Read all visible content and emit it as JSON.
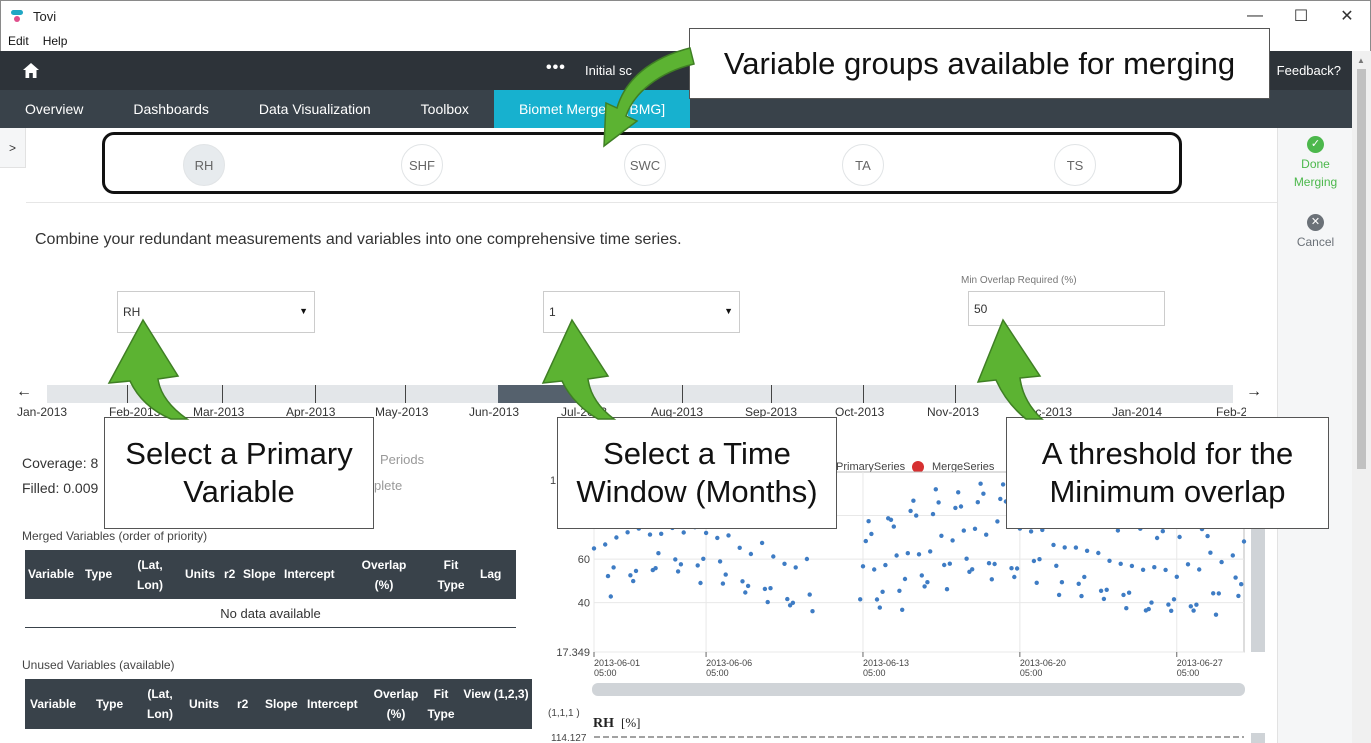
{
  "window": {
    "title": "Tovi",
    "controls": [
      "—",
      "☐",
      "✕"
    ]
  },
  "menu": [
    "Edit",
    "Help"
  ],
  "appbar": {
    "more": "•••",
    "project": "Initial sc",
    "feedback": "Feedback?"
  },
  "nav": {
    "tabs": [
      {
        "label": "Overview"
      },
      {
        "label": "Dashboards"
      },
      {
        "label": "Data Visualization"
      },
      {
        "label": "Toolbox"
      },
      {
        "label": "Biomet Merge ... [BMG]",
        "active": true
      }
    ]
  },
  "groups": [
    "RH",
    "SHF",
    "SWC",
    "TA",
    "TS"
  ],
  "right_panel": {
    "done": "Done Merging",
    "cancel": "Cancel"
  },
  "intro": "Combine your redundant measurements and variables into one comprehensive time series.",
  "controls": {
    "primary_variable": "RH",
    "time_window": "1",
    "min_overlap_label": "Min Overlap Required (%)",
    "min_overlap_value": "50"
  },
  "timeline": {
    "months": [
      "Jan-2013",
      "Feb-2013",
      "Mar-2013",
      "Apr-2013",
      "May-2013",
      "Jun-2013",
      "Jul-2013",
      "Aug-2013",
      "Sep-2013",
      "Oct-2013",
      "Nov-2013",
      "Dec-2013",
      "Jan-2014",
      "Feb-2014"
    ]
  },
  "stats": {
    "coverage": "Coverage: 8",
    "filled": "Filled: 0.009",
    "periods": "Periods",
    "complete": "plete"
  },
  "merged": {
    "title": "Merged Variables (order of priority)",
    "headers": [
      "Variable",
      "Type",
      "(Lat, Lon)",
      "Units",
      "r2",
      "Slope",
      "Intercept",
      "Overlap (%)",
      "Fit Type",
      "Lag"
    ],
    "empty": "No data available"
  },
  "unused": {
    "title": "Unused Variables (available)",
    "headers": [
      "Variable",
      "Type",
      "(Lat, Lon)",
      "Units",
      "r2",
      "Slope",
      "Intercept",
      "Overlap (%)",
      "Fit Type",
      "View (1,2,3)"
    ]
  },
  "chart_data": {
    "type": "scatter",
    "legend": [
      {
        "name": "PrimarySeries",
        "color": "#3e7cc4"
      },
      {
        "name": "MergeSeries",
        "color": "#d63031"
      }
    ],
    "y_ticks": [
      "17.349",
      "40",
      "60",
      "80"
    ],
    "y_top_partial": "1",
    "x_ticks": [
      {
        "date": "2013-06-01",
        "time": "05:00"
      },
      {
        "date": "2013-06-06",
        "time": "05:00"
      },
      {
        "date": "2013-06-13",
        "time": "05:00"
      },
      {
        "date": "2013-06-20",
        "time": "05:00"
      },
      {
        "date": "2013-06-27",
        "time": "05:00"
      }
    ],
    "ylim": [
      17.349,
      100
    ],
    "gap": [
      "2013-06-11",
      "2013-06-13"
    ],
    "second_chart": {
      "corner": "(1,1,1 )",
      "ylabel": "RH",
      "yunit": "[%]",
      "y_top": "114.127"
    }
  },
  "callouts": {
    "groups": "Variable groups available for merging",
    "primary": "Select a Primary Variable",
    "window": "Select a Time Window (Months)",
    "overlap": "A threshold for the Minimum overlap"
  },
  "colors": {
    "accent": "#17b1cf",
    "dark": "#2d3339",
    "nav": "#39424a",
    "arrow": "#5cb332",
    "done": "#4cb84c"
  }
}
